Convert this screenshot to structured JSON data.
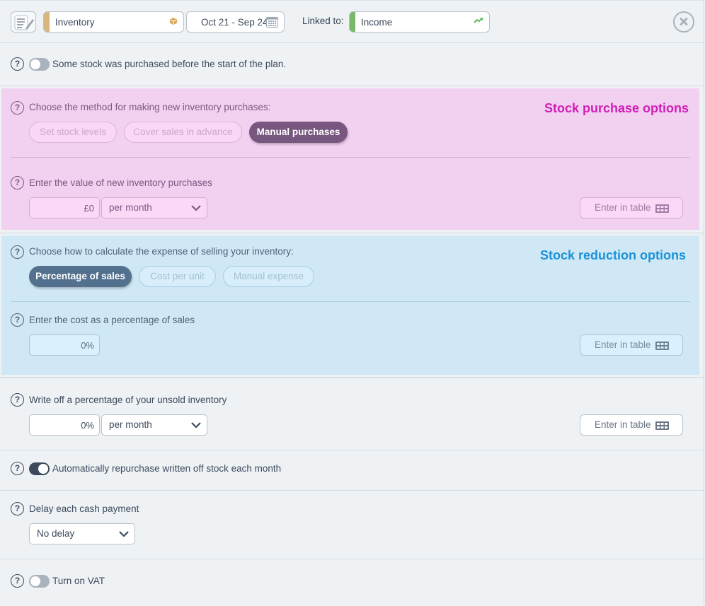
{
  "header": {
    "name_value": "Inventory",
    "date_range": "Oct 21 - Sep 24",
    "linked_label": "Linked to:",
    "linked_value": "Income",
    "colors": {
      "name_stripe": "#d6b67d",
      "linked_stripe": "#7ab86a"
    }
  },
  "prepurchase": {
    "label": "Some stock was purchased before the start of the plan.",
    "toggle_on": false
  },
  "purchase_panel": {
    "title": "Stock purchase options",
    "method_label": "Choose the method for making new inventory purchases:",
    "methods": [
      {
        "label": "Set stock levels",
        "active": false
      },
      {
        "label": "Cover sales in advance",
        "active": false
      },
      {
        "label": "Manual purchases",
        "active": true
      }
    ],
    "value_label": "Enter the value of new inventory purchases",
    "value": "£0",
    "frequency": "per month",
    "table_button": "Enter in table",
    "accent": "#d01fb8"
  },
  "reduction_panel": {
    "title": "Stock reduction options",
    "method_label": "Choose how to calculate the expense of selling your inventory:",
    "methods": [
      {
        "label": "Percentage of sales",
        "active": true
      },
      {
        "label": "Cost per unit",
        "active": false
      },
      {
        "label": "Manual expense",
        "active": false
      }
    ],
    "cost_label": "Enter the cost as a percentage of sales",
    "cost_value": "0%",
    "table_button": "Enter in table",
    "accent": "#1a93d6"
  },
  "writeoff": {
    "label": "Write off a percentage of your unsold inventory",
    "value": "0%",
    "frequency": "per month",
    "table_button": "Enter in table"
  },
  "repurchase": {
    "label": "Automatically repurchase written off stock each month",
    "toggle_on": true
  },
  "delay": {
    "label": "Delay each cash payment",
    "value": "No delay"
  },
  "vat": {
    "label": "Turn on VAT",
    "toggle_on": false
  },
  "help_glyph": "?"
}
